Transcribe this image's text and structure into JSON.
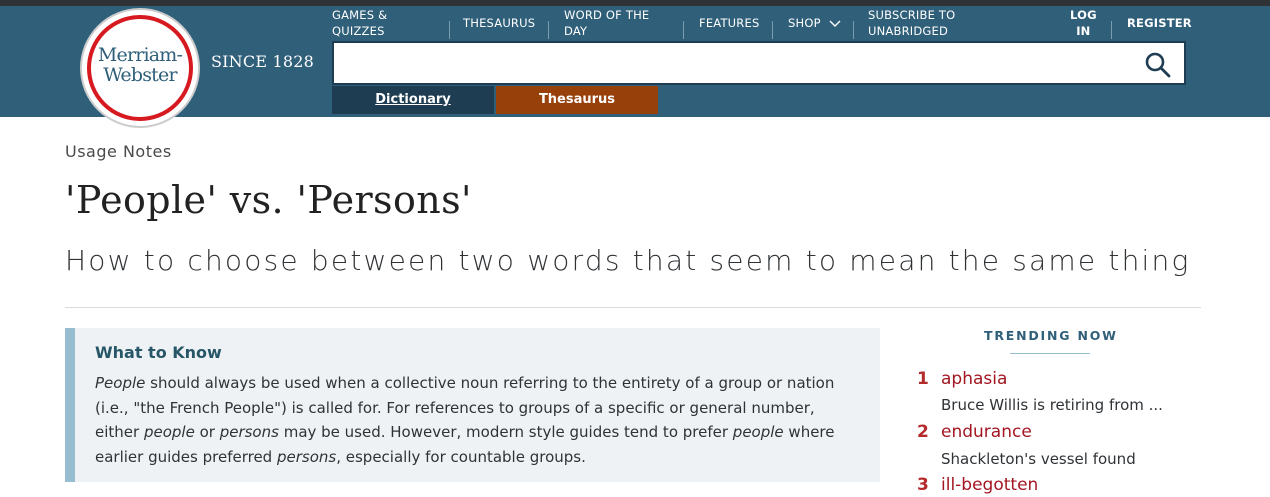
{
  "brand": {
    "logo_line1": "Merriam-",
    "logo_line2": "Webster",
    "since": "SINCE 1828",
    "colors": {
      "header": "#305f7a",
      "accent_red": "#d71920",
      "thesaurus_tab": "#97400a",
      "dictionary_tab": "#1f3d52"
    }
  },
  "nav": {
    "games_line1": "GAMES &",
    "games_line2": "QUIZZES",
    "thesaurus": "THESAURUS",
    "wotd_line1": "WORD OF THE",
    "wotd_line2": "DAY",
    "features": "FEATURES",
    "shop": "SHOP",
    "subscribe_line1": "SUBSCRIBE TO",
    "subscribe_line2": "UNABRIDGED",
    "login_line1": "LOG",
    "login_line2": "IN",
    "register": "REGISTER"
  },
  "search": {
    "value": "",
    "placeholder": "",
    "icon": "search-icon",
    "tab_dictionary": "Dictionary",
    "tab_thesaurus": "Thesaurus"
  },
  "article": {
    "eyebrow": "Usage Notes",
    "title": "'People' vs. 'Persons'",
    "subtitle": "How to choose between two words that seem to mean the same thing"
  },
  "what_to_know": {
    "heading": "What to Know",
    "p1_em1": "People",
    "p1_t1": " should always be used when a collective noun referring to the entirety of a group or nation (i.e., \"the French People\") is called for. For references to groups of a specific or general number, either ",
    "p1_em2": "people",
    "p1_t2": " or ",
    "p1_em3": "persons",
    "p1_t3": " may be used. However, modern style guides tend to prefer ",
    "p1_em4": "people",
    "p1_t4": " where earlier guides preferred ",
    "p1_em5": "persons",
    "p1_t5": ", especially for countable groups."
  },
  "trending": {
    "title": "TRENDING NOW",
    "items": [
      {
        "num": "1",
        "word": "aphasia",
        "desc": "Bruce Willis is retiring from ..."
      },
      {
        "num": "2",
        "word": "endurance",
        "desc": "Shackleton's vessel found"
      },
      {
        "num": "3",
        "word": "ill-begotten",
        "desc": ""
      }
    ]
  }
}
